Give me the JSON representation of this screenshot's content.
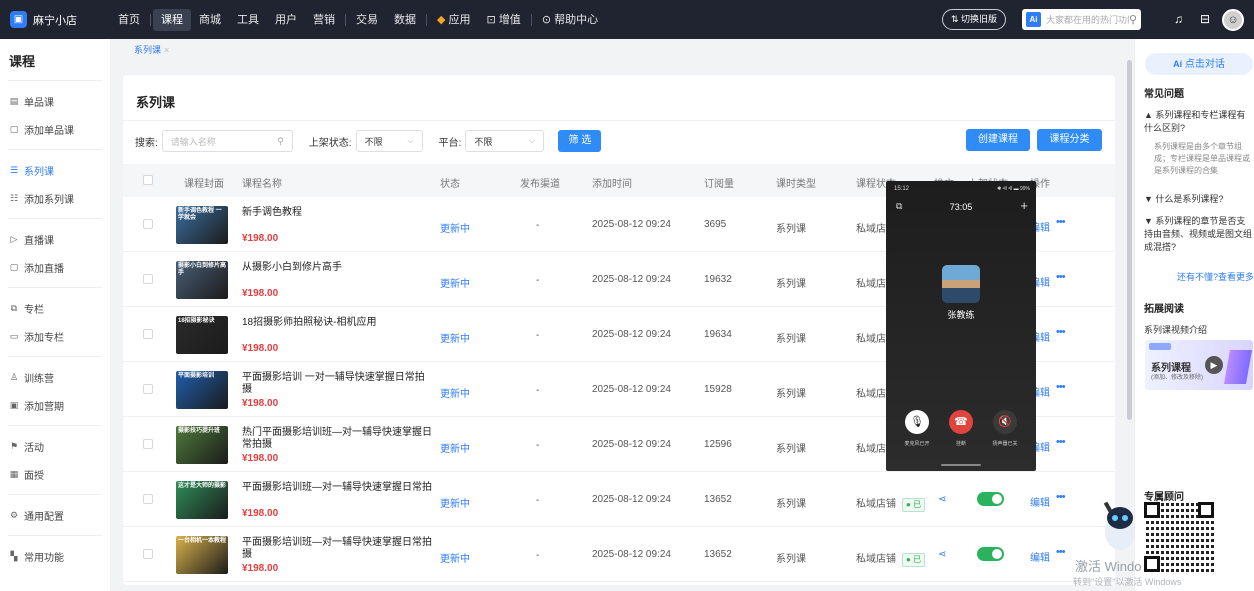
{
  "app": {
    "name": "麻宁小店"
  },
  "topnav": {
    "items": [
      "首页",
      "课程",
      "商城",
      "工具",
      "用户",
      "营销",
      "交易",
      "数据",
      "应用",
      "增值",
      "帮助中心"
    ],
    "switch_label": "切换旧版",
    "search_placeholder": "大家都在用的热门功能",
    "ai_badge": "Ai"
  },
  "sidebar": {
    "title": "课程",
    "groups": [
      [
        {
          "label": "单品课",
          "icon": "file-icon"
        },
        {
          "label": "添加单品课",
          "icon": "add-file-icon"
        }
      ],
      [
        {
          "label": "系列课",
          "icon": "list-icon",
          "active": true
        },
        {
          "label": "添加系列课",
          "icon": "add-list-icon"
        }
      ],
      [
        {
          "label": "直播课",
          "icon": "live-icon"
        },
        {
          "label": "添加直播",
          "icon": "add-live-icon"
        }
      ],
      [
        {
          "label": "专栏",
          "icon": "column-icon"
        },
        {
          "label": "添加专栏",
          "icon": "add-column-icon"
        }
      ],
      [
        {
          "label": "训练营",
          "icon": "camp-icon"
        },
        {
          "label": "添加营期",
          "icon": "add-camp-icon"
        }
      ],
      [
        {
          "label": "活动",
          "icon": "activity-icon"
        },
        {
          "label": "面授",
          "icon": "classroom-icon"
        }
      ],
      [
        {
          "label": "通用配置",
          "icon": "settings-icon"
        }
      ],
      [
        {
          "label": "常用功能",
          "icon": "grid-icon"
        }
      ]
    ]
  },
  "tab": {
    "label": "系列课"
  },
  "page": {
    "title": "系列课",
    "search_label": "搜索:",
    "search_placeholder": "请输入名称",
    "listing_label": "上架状态:",
    "listing_value": "不限",
    "platform_label": "平台:",
    "platform_value": "不限",
    "filter_button": "筛 选",
    "create_button": "创建课程",
    "category_button": "课程分类"
  },
  "table": {
    "headers": [
      "课程封面",
      "课程名称",
      "状态",
      "发布渠道",
      "添加时间",
      "订阅量",
      "课时类型",
      "课程状态",
      "推文",
      "上架状态",
      "操作"
    ],
    "rows": [
      {
        "name": "新手调色教程",
        "price": "¥198.00",
        "status": "更新中",
        "channel": "-",
        "time": "2025-08-12 09:24",
        "subs": "3695",
        "type": "系列课",
        "cstatus": "私域店铺",
        "cover_text": "新手调色教程 一学就会",
        "cover_color": "#3b6fa0"
      },
      {
        "name": "从摄影小白到修片高手",
        "price": "¥198.00",
        "status": "更新中",
        "channel": "-",
        "time": "2025-08-12 09:24",
        "subs": "19632",
        "type": "系列课",
        "cstatus": "私域店铺",
        "cover_text": "摄影小白到修片高手",
        "cover_color": "#4a5f78"
      },
      {
        "name": "18招摄影师拍照秘诀-相机应用",
        "price": "¥198.00",
        "status": "更新中",
        "channel": "-",
        "time": "2025-08-12 09:24",
        "subs": "19634",
        "type": "系列课",
        "cstatus": "私域店铺",
        "cover_text": "18招摄影秘诀",
        "cover_color": "#2b2b2b"
      },
      {
        "name": "平面摄影培训 一对一辅导快速掌握日常拍摄",
        "price": "¥198.00",
        "status": "更新中",
        "channel": "-",
        "time": "2025-08-12 09:24",
        "subs": "15928",
        "type": "系列课",
        "cstatus": "私域店铺",
        "cover_text": "平面摄影培训",
        "cover_color": "#1f5fb0"
      },
      {
        "name": "热门平面摄影培训班—对一辅导快速掌握日常拍摄",
        "price": "¥198.00",
        "status": "更新中",
        "channel": "-",
        "time": "2025-08-12 09:24",
        "subs": "12596",
        "type": "系列课",
        "cstatus": "私域店铺",
        "cover_text": "摄影技巧提升班",
        "cover_color": "#4e7a3a"
      },
      {
        "name": "平面摄影培训班—对一辅导快速掌握日常拍",
        "price": "¥198.00",
        "status": "更新中",
        "channel": "-",
        "time": "2025-08-12 09:24",
        "subs": "13652",
        "type": "系列课",
        "cstatus": "私域店铺",
        "cover_text": "这才是大师的摄影",
        "cover_color": "#2e8f5a"
      },
      {
        "name": "平面摄影培训班—对一辅导快速掌握日常拍摄",
        "price": "¥198.00",
        "status": "更新中",
        "channel": "-",
        "time": "2025-08-12 09:24",
        "subs": "13652",
        "type": "系列课",
        "cstatus": "私域店铺",
        "cover_text": "一台相机一本教程",
        "cover_color": "#d9b24a"
      }
    ],
    "edit_label": "编辑",
    "more_label": "•••",
    "badge_label": "已"
  },
  "right_panel": {
    "ai_chat": "点击对话",
    "faq_title": "常见问题",
    "faq": [
      {
        "q": "▲ 系列课程和专栏课程有什么区别?",
        "a": "系列课程是由多个章节组成；专栏课程是单品课程或是系列课程的合集"
      },
      {
        "q": "▼ 什么是系列课程?"
      },
      {
        "q": "▼ 系列课程的章节是否支持由音频、视频或是图文组成混搭?"
      }
    ],
    "more_link": "还有不懂?查看更多 »",
    "reading_title": "拓展阅读",
    "reading_item": "系列课视频介绍",
    "banner_title": "系列课程",
    "banner_sub": "(添加、修改及移除)",
    "consultant_title": "专属顾问"
  },
  "call": {
    "status_time": "15:12",
    "status_right": "99%",
    "timer": "73:05",
    "name": "张教练",
    "mic_label": "麦克风已开",
    "hangup_label": "挂断",
    "speaker_label": "扬声器已关"
  },
  "watermark": {
    "line1": "激活 Windo",
    "line2": "转到\"设置\"以激活 Windows"
  }
}
